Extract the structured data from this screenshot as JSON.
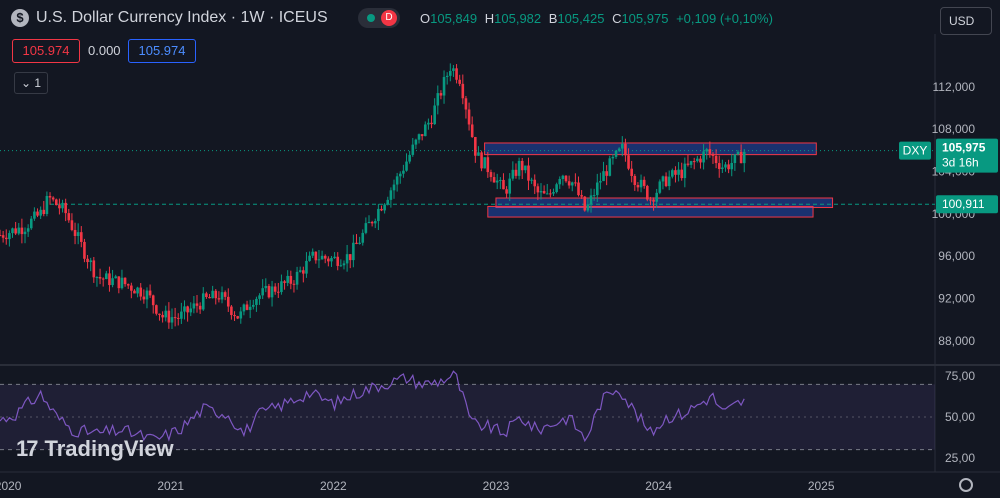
{
  "header": {
    "symbol_icon": "dollar-icon",
    "title": "U.S. Dollar Currency Index · 1W · ICEUS",
    "status_letter": "D",
    "open_key": "O",
    "open": "105,849",
    "high_key": "H",
    "high": "105,982",
    "low_key": "B",
    "low": "105,425",
    "close_key": "C",
    "close": "105,975",
    "change": "+0,109 (+0,10%)",
    "currency": "USD"
  },
  "quote_boxes": {
    "sell": "105.974",
    "spread": "0.000",
    "buy": "105.974"
  },
  "indicator_toggle": "1",
  "watermark": "TradingView",
  "price_labels": {
    "symbol": "DXY",
    "last_price": "105,975",
    "countdown": "3d 16h",
    "line_price": "100,911"
  },
  "colors": {
    "up": "#089981",
    "down": "#f23645",
    "rsi": "#7e57c2",
    "zone_fill": "#2962ff",
    "zone_border": "#f23645"
  },
  "chart_data": {
    "type": "candlestick",
    "price_axis": {
      "ticks": [
        "88,000",
        "92,000",
        "96,000",
        "100,000",
        "104,000",
        "108,000",
        "112,000"
      ],
      "tick_values": [
        88,
        92,
        96,
        100,
        104,
        108,
        112
      ],
      "range": [
        86,
        117
      ]
    },
    "time_axis": {
      "ticks": [
        "2020",
        "2021",
        "2022",
        "2023",
        "2024",
        "2025"
      ],
      "range": [
        2019.95,
        2025.7
      ]
    },
    "weekly_closes_keypoints": [
      [
        2019.95,
        98.0
      ],
      [
        2020.1,
        98.8
      ],
      [
        2020.2,
        100.0
      ],
      [
        2020.25,
        101.5
      ],
      [
        2020.35,
        100.2
      ],
      [
        2020.45,
        97.0
      ],
      [
        2020.55,
        94.0
      ],
      [
        2020.7,
        93.5
      ],
      [
        2020.85,
        92.5
      ],
      [
        2020.95,
        90.3
      ],
      [
        2021.05,
        90.2
      ],
      [
        2021.2,
        91.8
      ],
      [
        2021.3,
        92.3
      ],
      [
        2021.42,
        90.2
      ],
      [
        2021.5,
        92.0
      ],
      [
        2021.62,
        92.8
      ],
      [
        2021.75,
        93.7
      ],
      [
        2021.88,
        96.0
      ],
      [
        2022.0,
        95.7
      ],
      [
        2022.1,
        96.0
      ],
      [
        2022.2,
        98.5
      ],
      [
        2022.3,
        101.0
      ],
      [
        2022.4,
        103.5
      ],
      [
        2022.5,
        106.5
      ],
      [
        2022.6,
        109.0
      ],
      [
        2022.72,
        114.0
      ],
      [
        2022.78,
        112.8
      ],
      [
        2022.88,
        105.5
      ],
      [
        2022.97,
        104.0
      ],
      [
        2023.05,
        102.0
      ],
      [
        2023.15,
        104.8
      ],
      [
        2023.25,
        102.0
      ],
      [
        2023.32,
        101.5
      ],
      [
        2023.4,
        104.0
      ],
      [
        2023.48,
        102.8
      ],
      [
        2023.55,
        100.2
      ],
      [
        2023.65,
        103.5
      ],
      [
        2023.72,
        105.0
      ],
      [
        2023.78,
        106.2
      ],
      [
        2023.85,
        103.5
      ],
      [
        2023.95,
        101.5
      ],
      [
        2024.05,
        103.3
      ],
      [
        2024.15,
        104.0
      ],
      [
        2024.3,
        105.9
      ],
      [
        2024.4,
        104.4
      ],
      [
        2024.5,
        105.3
      ],
      [
        2024.53,
        105.975
      ]
    ],
    "horizontal_line": 100.911,
    "last_price": 105.975,
    "zones": [
      {
        "t_start": 2022.93,
        "t_end": 2024.97,
        "p_low": 105.6,
        "p_high": 106.7
      },
      {
        "t_start": 2023.0,
        "t_end": 2025.07,
        "p_low": 100.6,
        "p_high": 101.5
      },
      {
        "t_start": 2022.95,
        "t_end": 2024.95,
        "p_low": 99.7,
        "p_high": 100.7
      }
    ],
    "rsi": {
      "ticks": [
        "25,00",
        "50,00",
        "75,00"
      ],
      "tick_values": [
        25,
        50,
        75
      ],
      "range": [
        20,
        80
      ],
      "band": [
        30,
        70
      ],
      "keypoints": [
        [
          2019.95,
          48
        ],
        [
          2020.05,
          52
        ],
        [
          2020.12,
          58
        ],
        [
          2020.2,
          64
        ],
        [
          2020.3,
          50
        ],
        [
          2020.4,
          42
        ],
        [
          2020.55,
          40
        ],
        [
          2020.7,
          42
        ],
        [
          2020.9,
          36
        ],
        [
          2021.05,
          42
        ],
        [
          2021.2,
          55
        ],
        [
          2021.35,
          52
        ],
        [
          2021.45,
          40
        ],
        [
          2021.55,
          52
        ],
        [
          2021.7,
          58
        ],
        [
          2021.85,
          65
        ],
        [
          2022.0,
          58
        ],
        [
          2022.15,
          65
        ],
        [
          2022.3,
          70
        ],
        [
          2022.45,
          74
        ],
        [
          2022.55,
          70
        ],
        [
          2022.65,
          72
        ],
        [
          2022.75,
          76
        ],
        [
          2022.85,
          46
        ],
        [
          2022.95,
          44
        ],
        [
          2023.05,
          40
        ],
        [
          2023.15,
          50
        ],
        [
          2023.25,
          42
        ],
        [
          2023.35,
          46
        ],
        [
          2023.45,
          50
        ],
        [
          2023.55,
          36
        ],
        [
          2023.65,
          60
        ],
        [
          2023.75,
          69
        ],
        [
          2023.82,
          58
        ],
        [
          2023.95,
          40
        ],
        [
          2024.05,
          50
        ],
        [
          2024.15,
          52
        ],
        [
          2024.25,
          58
        ],
        [
          2024.33,
          63
        ],
        [
          2024.4,
          52
        ],
        [
          2024.48,
          58
        ],
        [
          2024.53,
          60
        ]
      ]
    }
  }
}
